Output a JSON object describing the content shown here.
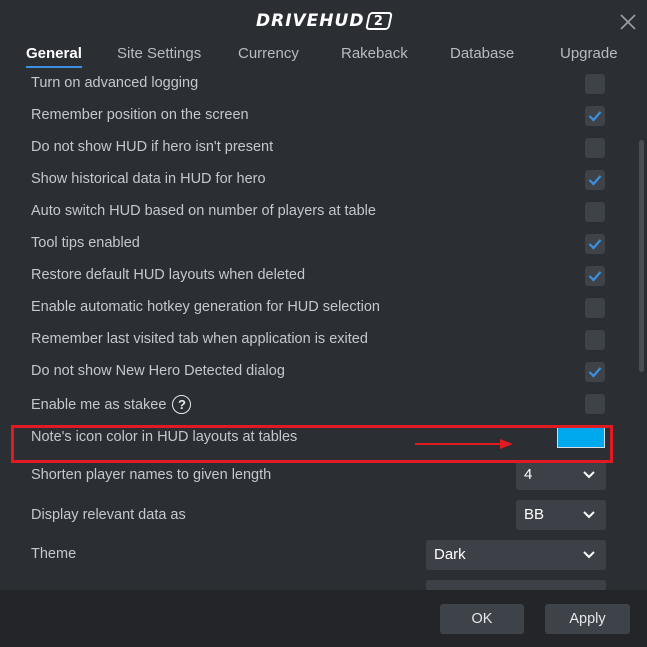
{
  "app": {
    "logo_text": "DRIVEHUD",
    "logo_badge": "2"
  },
  "tabs": [
    {
      "label": "General",
      "active": true
    },
    {
      "label": "Site Settings"
    },
    {
      "label": "Currency"
    },
    {
      "label": "Rakeback"
    },
    {
      "label": "Database"
    },
    {
      "label": "Upgrade"
    }
  ],
  "settings": [
    {
      "label": "Turn on advanced logging",
      "control": "checkbox",
      "checked": false
    },
    {
      "label": "Remember position on the screen",
      "control": "checkbox",
      "checked": true
    },
    {
      "label": "Do not show HUD if hero isn't present",
      "control": "checkbox",
      "checked": false
    },
    {
      "label": "Show historical data in HUD for hero",
      "control": "checkbox",
      "checked": true
    },
    {
      "label": "Auto switch HUD based on number of players at table",
      "control": "checkbox",
      "checked": false
    },
    {
      "label": "Tool tips enabled",
      "control": "checkbox",
      "checked": true
    },
    {
      "label": "Restore default HUD layouts when deleted",
      "control": "checkbox",
      "checked": true
    },
    {
      "label": "Enable automatic hotkey generation for HUD selection",
      "control": "checkbox",
      "checked": false
    },
    {
      "label": "Remember last visited tab when application is exited",
      "control": "checkbox",
      "checked": false
    },
    {
      "label": "Do not show New Hero Detected dialog",
      "control": "checkbox",
      "checked": true
    },
    {
      "label": "Enable me as stakee",
      "control": "checkbox",
      "checked": false,
      "help_icon": "question-circle-icon"
    },
    {
      "label": "Note's icon color in HUD layouts at tables",
      "control": "color",
      "color": "#00a9ee"
    },
    {
      "label": "Shorten player names to given length",
      "control": "select",
      "value": "4"
    },
    {
      "label": "Display relevant data as",
      "control": "select",
      "value": "BB",
      "highlighted": true
    },
    {
      "label": "Theme",
      "control": "select",
      "value": "Dark"
    }
  ],
  "footer": {
    "ok_label": "OK",
    "apply_label": "Apply"
  },
  "colors": {
    "background": "#2b2e33",
    "accent_tab": "#3b8fe0",
    "checkmark": "#3b8fe0",
    "highlight": "#e01c22",
    "note_icon_color": "#00a9ee"
  }
}
